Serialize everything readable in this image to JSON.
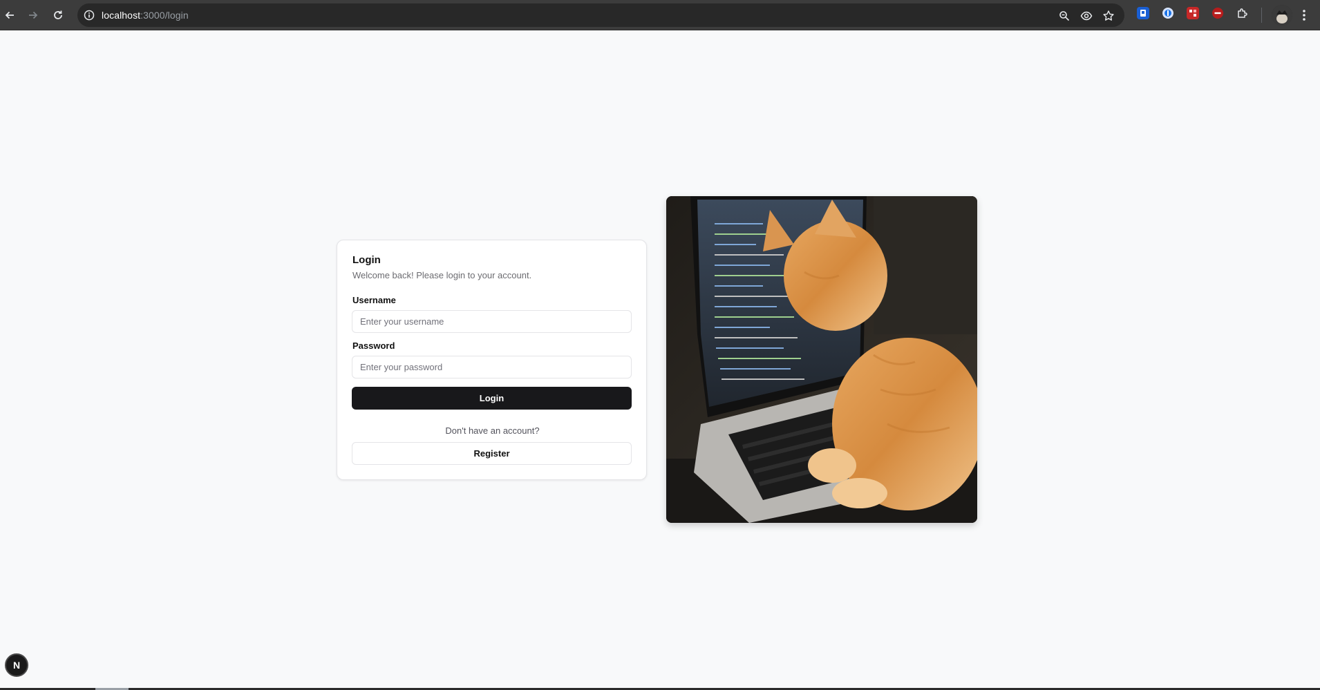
{
  "browser": {
    "url_host": "localhost",
    "url_path": ":3000/login",
    "colors": {
      "chrome": "#3c3c3c",
      "omnibox": "#282828"
    },
    "icons": [
      "back-arrow-icon",
      "forward-arrow-icon",
      "reload-icon",
      "site-info-icon",
      "zoom-icon",
      "eye-icon",
      "bookmark-star-icon",
      "extension-1-icon",
      "extension-2-icon",
      "extension-3-icon",
      "extension-4-icon",
      "extensions-puzzle-icon",
      "profile-avatar",
      "kebab-menu-icon"
    ]
  },
  "login": {
    "title": "Login",
    "description": "Welcome back! Please login to your account.",
    "username_label": "Username",
    "username_placeholder": "Enter your username",
    "username_value": "",
    "password_label": "Password",
    "password_placeholder": "Enter your password",
    "password_value": "",
    "login_button": "Login",
    "no_account_text": "Don't have an account?",
    "register_button": "Register"
  },
  "dev_indicator": {
    "label": "N"
  },
  "colors": {
    "page_bg": "#f8f9fa",
    "primary_button": "#18181b",
    "card_border": "#e4e4e7"
  }
}
